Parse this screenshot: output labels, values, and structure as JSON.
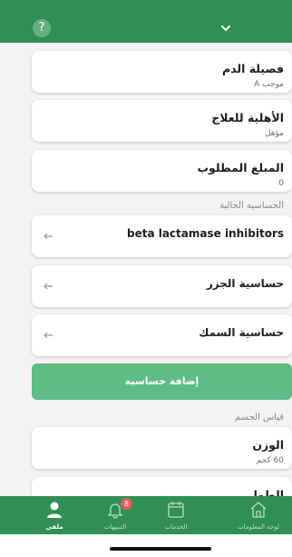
{
  "header": {
    "help_label": "?"
  },
  "cards": [
    {
      "title": "فصيلة الدم",
      "value": "موجب A"
    },
    {
      "title": "الأهلية للعلاج",
      "value": "مؤهل"
    },
    {
      "title": "المبلغ المطلوب",
      "value": "0"
    }
  ],
  "allergies": {
    "section_label": "الحساسية الحالية",
    "items": [
      {
        "label": "beta lactamase inhibitors"
      },
      {
        "label": "حساسية الجزر"
      },
      {
        "label": "حساسية السمك"
      }
    ],
    "add_button": "إضافة حساسية"
  },
  "body_measure": {
    "section_label": "قياس الجسم",
    "items": [
      {
        "title": "الوزن",
        "value": "60 كجم"
      },
      {
        "title": "الطول",
        "value": ""
      }
    ]
  },
  "bottom_nav": {
    "items": [
      {
        "label": "ملفي",
        "icon": "person-icon",
        "active": true
      },
      {
        "label": "التنبيهات",
        "icon": "bell-icon",
        "badge": "8"
      },
      {
        "label": "الخدمات",
        "icon": "calendar-icon"
      },
      {
        "label": "لوحة المعلومات",
        "icon": "home-icon"
      }
    ]
  },
  "colors": {
    "primary": "#2f8f54",
    "button": "#5dbd84",
    "badge": "#e45a5a"
  }
}
